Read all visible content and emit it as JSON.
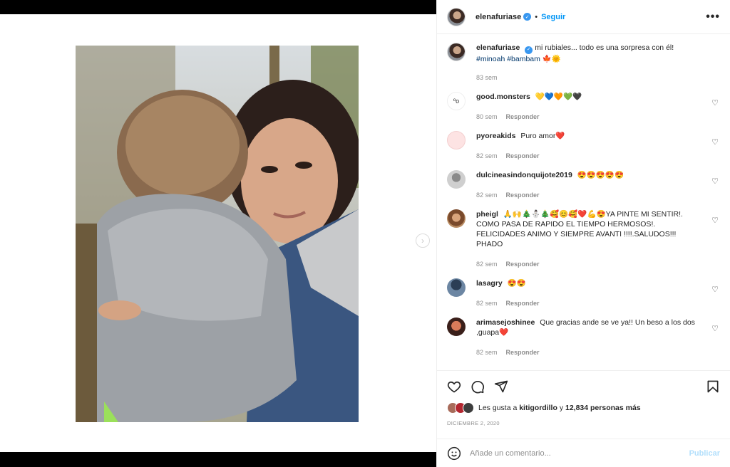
{
  "post": {
    "username": "elenafuriase",
    "separator": "•",
    "follow_label": "Seguir",
    "more_label": "•••"
  },
  "caption": {
    "username": "elenafuriase",
    "text": "mi rubiales... todo es una sorpresa con él!",
    "tags": "#minoah #bambam",
    "emoji": "🍁🌞",
    "time": "83 sem"
  },
  "comments": [
    {
      "username": "good.monsters",
      "text": "💛💙🧡💚🖤",
      "time": "80 sem",
      "reply": "Responder"
    },
    {
      "username": "pyoreakids",
      "text": "Puro amor❤️",
      "time": "82 sem",
      "reply": "Responder"
    },
    {
      "username": "dulcineasindonquijote2019",
      "text": "😍😍😍😍😍",
      "time": "82 sem",
      "reply": "Responder"
    },
    {
      "username": "pheigl",
      "text": "🙏🙌🎄⛄🎄🥰😊🥰❤️💪😍YA PINTE MI SENTIR!. COMO PASA DE RAPIDO EL TIEMPO HERMOSOS!. FELICIDADES ANIMO Y SIEMPRE AVANTI !!!!.SALUDOS!!! PHADO",
      "time": "82 sem",
      "reply": "Responder"
    },
    {
      "username": "lasagry",
      "text": "😍😍",
      "time": "82 sem",
      "reply": "Responder"
    },
    {
      "username": "arimasejoshinee",
      "text": "Que gracias ande se ve ya!! Un beso a los dos ,guapa❤️",
      "time": "82 sem",
      "reply": "Responder"
    }
  ],
  "likes": {
    "prefix": "Les gusta a",
    "user": "kitigordillo",
    "suffix": "y",
    "count": "12,834 personas más"
  },
  "date": "DICIEMBRE 2, 2020",
  "add_comment": {
    "placeholder": "Añade un comentario...",
    "publish_label": "Publicar"
  },
  "icons": {
    "like": "heart-icon",
    "comment": "comment-icon",
    "share": "share-icon",
    "save": "bookmark-icon",
    "emoji": "smiley-icon",
    "next": "chevron-right-icon"
  },
  "colors": {
    "link": "#0095f6",
    "tag": "#00376b",
    "muted": "#8e8e8e",
    "publish_disabled": "#b2dffc"
  }
}
